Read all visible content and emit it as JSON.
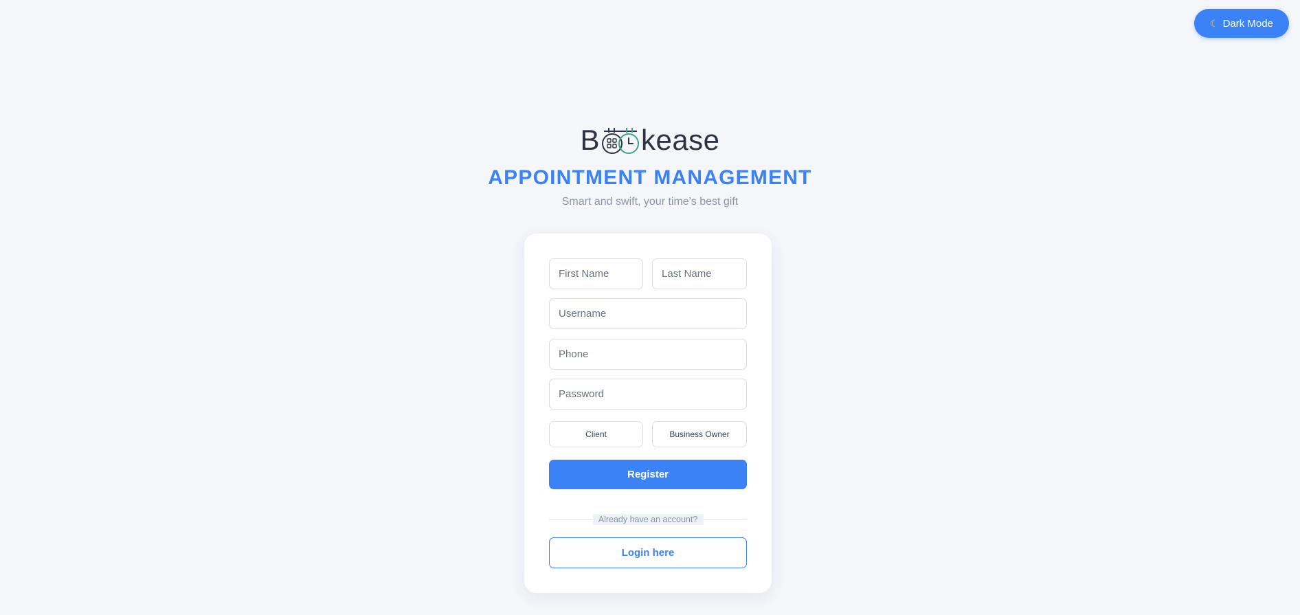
{
  "theme_toggle": {
    "label": "Dark Mode",
    "icon": "moon-icon"
  },
  "brand": {
    "logo_prefix": "B",
    "logo_suffix": "kease",
    "title": "APPOINTMENT MANAGEMENT",
    "subtitle": "Smart and swift, your time's best gift"
  },
  "form": {
    "first_name_placeholder": "First Name",
    "last_name_placeholder": "Last Name",
    "username_placeholder": "Username",
    "phone_placeholder": "Phone",
    "password_placeholder": "Password",
    "roles": [
      "Client",
      "Business Owner"
    ],
    "register_label": "Register",
    "divider_text": "Already have an account?",
    "login_label": "Login here"
  },
  "colors": {
    "accent": "#3b82f6",
    "background": "#f4f6fa",
    "logo_green": "#3aa58a",
    "logo_dark": "#2d3340"
  }
}
